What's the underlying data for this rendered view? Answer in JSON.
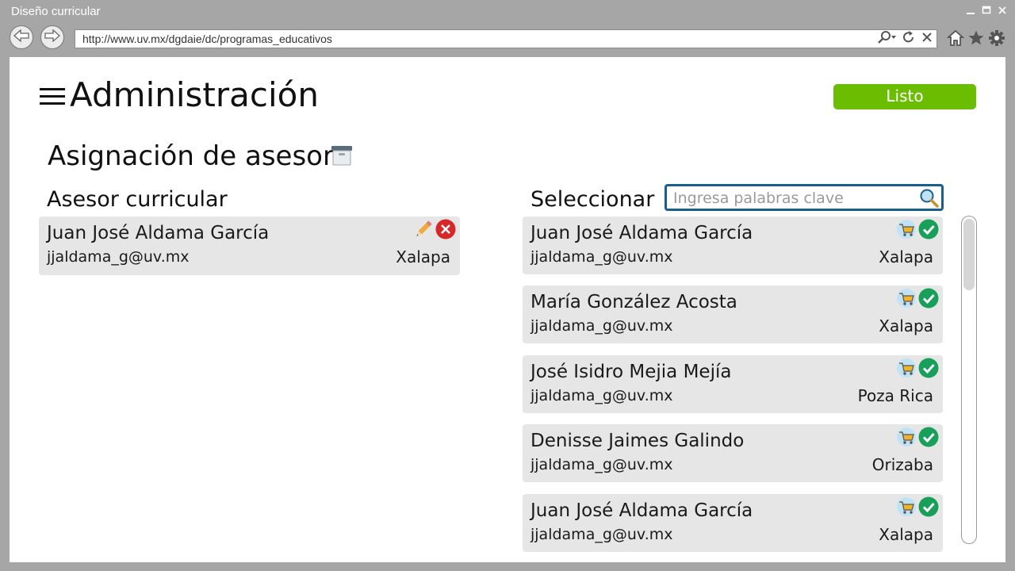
{
  "window": {
    "title": "Diseño curricular"
  },
  "browser": {
    "url": "http://www.uv.mx/dgdaie/dc/programas_educativos"
  },
  "header": {
    "title": "Administración",
    "done_label": "Listo"
  },
  "section": {
    "title": "Asignación de asesor"
  },
  "assigned": {
    "heading": "Asesor curricular",
    "card": {
      "name": "Juan José Aldama García",
      "email": "jjaldama_g@uv.mx",
      "city": "Xalapa"
    }
  },
  "select": {
    "heading": "Seleccionar",
    "search_placeholder": "Ingresa palabras clave",
    "items": [
      {
        "name": "Juan José Aldama García",
        "email": "jjaldama_g@uv.mx",
        "city": "Xalapa"
      },
      {
        "name": "María González Acosta",
        "email": "jjaldama_g@uv.mx",
        "city": "Xalapa"
      },
      {
        "name": "José Isidro Mejia Mejía",
        "email": "jjaldama_g@uv.mx",
        "city": "Poza Rica"
      },
      {
        "name": "Denisse Jaimes Galindo",
        "email": "jjaldama_g@uv.mx",
        "city": "Orizaba"
      },
      {
        "name": "Juan José Aldama García",
        "email": "jjaldama_g@uv.mx",
        "city": "Xalapa"
      }
    ]
  },
  "colors": {
    "accent_green": "#6abd00",
    "card_bg": "#e7e6e6",
    "search_border": "#1a5f8c",
    "check_green": "#18a05a",
    "delete_red": "#d62828"
  },
  "icons": [
    "back-icon",
    "forward-icon",
    "search-icon",
    "refresh-icon",
    "close-icon",
    "home-icon",
    "star-icon",
    "gear-icon",
    "menu-icon",
    "archive-icon",
    "edit-icon",
    "delete-icon",
    "cart-icon",
    "check-icon"
  ]
}
